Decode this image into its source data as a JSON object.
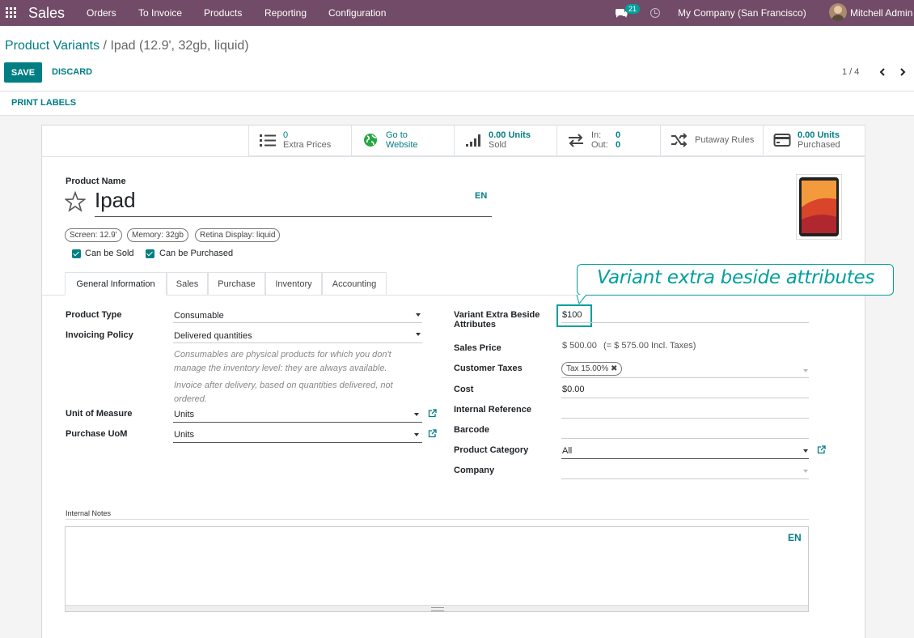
{
  "nav": {
    "app_name": "Sales",
    "menu": [
      "Orders",
      "To Invoice",
      "Products",
      "Reporting",
      "Configuration"
    ],
    "chat_count": "21",
    "company": "My Company (San Francisco)",
    "user": "Mitchell Admin"
  },
  "breadcrumb": {
    "parent": "Product Variants",
    "separator": " / ",
    "current": "Ipad (12.9', 32gb, liquid)"
  },
  "actions": {
    "save": "SAVE",
    "discard": "DISCARD",
    "print_labels": "PRINT LABELS"
  },
  "pager": {
    "text": "1 / 4"
  },
  "smart_buttons": {
    "extra_prices": {
      "value": "0",
      "label": "Extra Prices"
    },
    "website": {
      "line1": "Go to",
      "line2": "Website"
    },
    "sold": {
      "value": "0.00 Units",
      "label": "Sold"
    },
    "in_out": {
      "in_label": "In:",
      "in_value": "0",
      "out_label": "Out:",
      "out_value": "0"
    },
    "putaway": {
      "label": "Putaway Rules"
    },
    "purchased": {
      "value": "0.00 Units",
      "label": "Purchased"
    }
  },
  "product": {
    "name_label": "Product Name",
    "name": "Ipad",
    "lang": "EN",
    "attributes": [
      "Screen: 12.9'",
      "Memory: 32gb",
      "Retina Display: liquid"
    ],
    "can_be_sold": "Can be Sold",
    "can_be_purchased": "Can be Purchased"
  },
  "tabs": [
    "General Information",
    "Sales",
    "Purchase",
    "Inventory",
    "Accounting"
  ],
  "callout": {
    "text": "Variant extra beside attributes"
  },
  "left_fields": {
    "product_type": {
      "label": "Product Type",
      "value": "Consumable"
    },
    "invoicing_policy": {
      "label": "Invoicing Policy",
      "value": "Delivered quantities"
    },
    "help_consumable_1": "Consumables are physical products for which you don't",
    "help_consumable_2": "manage the inventory level: they are always available.",
    "help_invoice_1": "Invoice after delivery, based on quantities delivered, not",
    "help_invoice_2": "ordered.",
    "uom": {
      "label": "Unit of Measure",
      "value": "Units"
    },
    "purchase_uom": {
      "label": "Purchase UoM",
      "value": "Units"
    }
  },
  "right_fields": {
    "variant_extra": {
      "label_1": "Variant Extra Beside",
      "label_2": "Attributes",
      "value": "$100"
    },
    "sales_price": {
      "label": "Sales Price",
      "value": "$ 500.00",
      "incl": "(= $ 575.00 Incl. Taxes)"
    },
    "customer_taxes": {
      "label": "Customer Taxes",
      "tag": "Tax 15.00%"
    },
    "cost": {
      "label": "Cost",
      "value": "$0.00"
    },
    "internal_ref": {
      "label": "Internal Reference",
      "value": ""
    },
    "barcode": {
      "label": "Barcode",
      "value": ""
    },
    "product_category": {
      "label": "Product Category",
      "value": "All"
    },
    "company": {
      "label": "Company",
      "value": ""
    }
  },
  "notes": {
    "label": "Internal Notes",
    "lang": "EN"
  }
}
